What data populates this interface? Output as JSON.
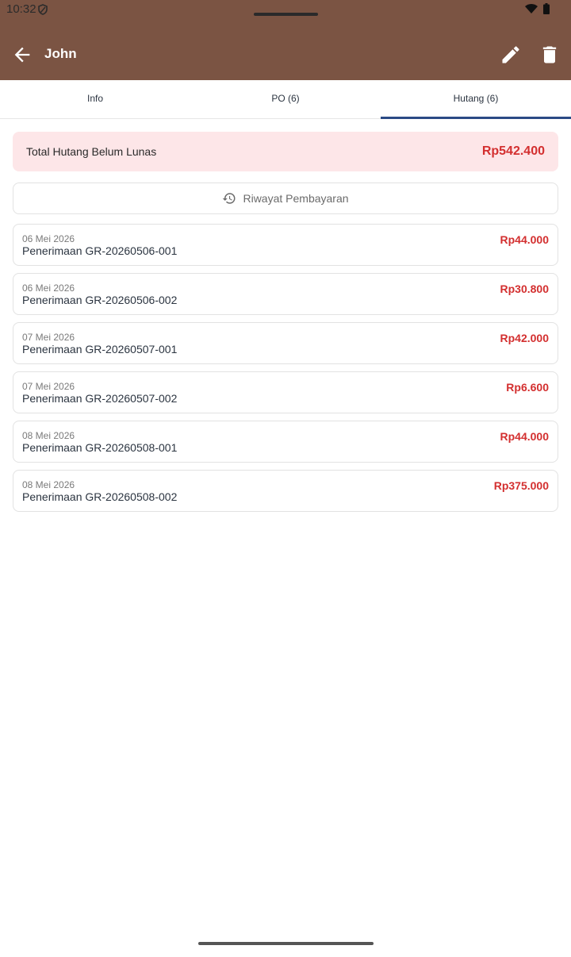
{
  "status_bar": {
    "time": "10:32",
    "icons": [
      "shield-icon",
      "wifi-icon",
      "battery-icon"
    ]
  },
  "app_bar": {
    "title": "John",
    "icons": [
      "back-arrow-icon",
      "edit-pencil-icon",
      "delete-trash-icon"
    ],
    "color": "#7b5443"
  },
  "tabs": [
    {
      "label": "Info",
      "active": false
    },
    {
      "label": "PO (6)",
      "active": false
    },
    {
      "label": "Hutang (6)",
      "active": true
    }
  ],
  "summary": {
    "label": "Total Hutang Belum Lunas",
    "value": "Rp542.400"
  },
  "history_button": {
    "label": "Riwayat Pembayaran",
    "icon": "history-icon"
  },
  "debts": [
    {
      "date": "06 Mei 2026",
      "title": "Penerimaan GR-20260506-001",
      "amount": "Rp44.000"
    },
    {
      "date": "06 Mei 2026",
      "title": "Penerimaan GR-20260506-002",
      "amount": "Rp30.800"
    },
    {
      "date": "07 Mei 2026",
      "title": "Penerimaan GR-20260507-001",
      "amount": "Rp42.000"
    },
    {
      "date": "07 Mei 2026",
      "title": "Penerimaan GR-20260507-002",
      "amount": "Rp6.600"
    },
    {
      "date": "08 Mei 2026",
      "title": "Penerimaan GR-20260508-001",
      "amount": "Rp44.000"
    },
    {
      "date": "08 Mei 2026",
      "title": "Penerimaan GR-20260508-002",
      "amount": "Rp375.000"
    }
  ],
  "colors": {
    "accent": "#2b4a85",
    "debt_red": "#d32f2f",
    "summary_bg": "#fde6e8"
  }
}
